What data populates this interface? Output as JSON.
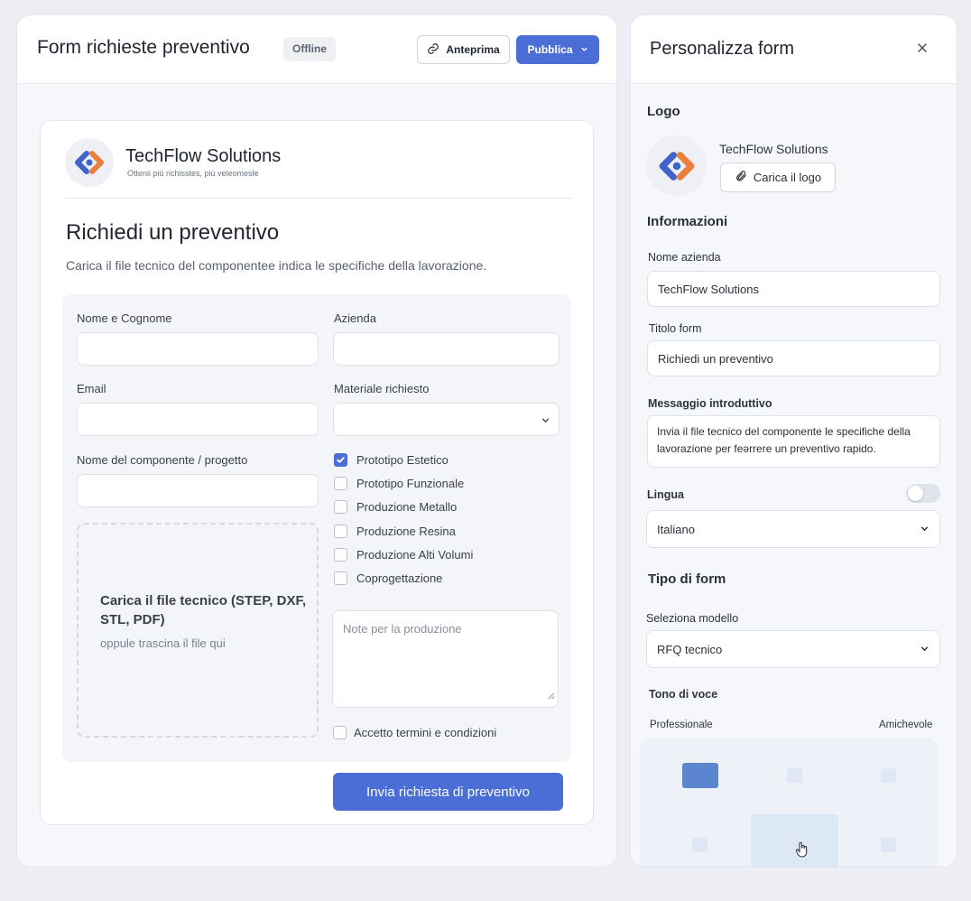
{
  "editor": {
    "title": "Form richieste preventivo",
    "status_badge": "Offline",
    "preview_label": "Anteprima",
    "publish_label": "Pubblica"
  },
  "form": {
    "company_name": "TechFlow Solutions",
    "tagline": "Ottenii più richisstes, più veleomesle",
    "heading": "Richiedi un preventivo",
    "intro": "Carica il file tecnico del componentee indica le specifiche della lavorazione.",
    "fields": {
      "name_label": "Nome e Cognome",
      "company_label": "Azienda",
      "email_label": "Email",
      "material_label": "Materiale richiesto",
      "project_label": "Nome del componente / progetto"
    },
    "upload": {
      "title": "Carica il file tecnico (STEP, DXF, STL, PDF)",
      "hint": "oppule trascina il file qui"
    },
    "options": [
      {
        "label": "Prototipo Estetico",
        "checked": true
      },
      {
        "label": "Prototipo Funzionale",
        "checked": false
      },
      {
        "label": "Produzione Metallo",
        "checked": false
      },
      {
        "label": "Produzione Resina",
        "checked": false
      },
      {
        "label": "Produzione Alti Volumi",
        "checked": false
      },
      {
        "label": "Coprogettazione",
        "checked": false
      }
    ],
    "notes_placeholder": "Note per la produzione",
    "terms_label": "Accetto termini e condizioni",
    "submit_label": "Invia richiesta di preventivo"
  },
  "customize": {
    "title": "Personalizza form",
    "logo_section": "Logo",
    "logo_company": "TechFlow Solutions",
    "upload_logo_label": "Carica il logo",
    "info_section": "Informazioni",
    "company_name_label": "Nome azienda",
    "company_name_value": "TechFlow Solutions",
    "form_title_label": "Titolo form",
    "form_title_value": "Richiedi un preventivo",
    "intro_message_label": "Messaggio introduttivo",
    "intro_message_value": "Invia il file tecnico del componente le specifiche della lavorazione per feərrere un preventivo rapido.",
    "language_label": "Lingua",
    "language_value": "Italiano",
    "language_toggle_on": false,
    "form_type_section": "Tipo di form",
    "template_label": "Seleziona modello",
    "template_value": "RFQ tecnico",
    "tone_section": "Tono di voce",
    "tone_left": "Professionale",
    "tone_right": "Amichevole"
  },
  "colors": {
    "accent": "#4a6ed6",
    "logo_blue": "#3f63c9",
    "logo_orange": "#e9803d"
  }
}
